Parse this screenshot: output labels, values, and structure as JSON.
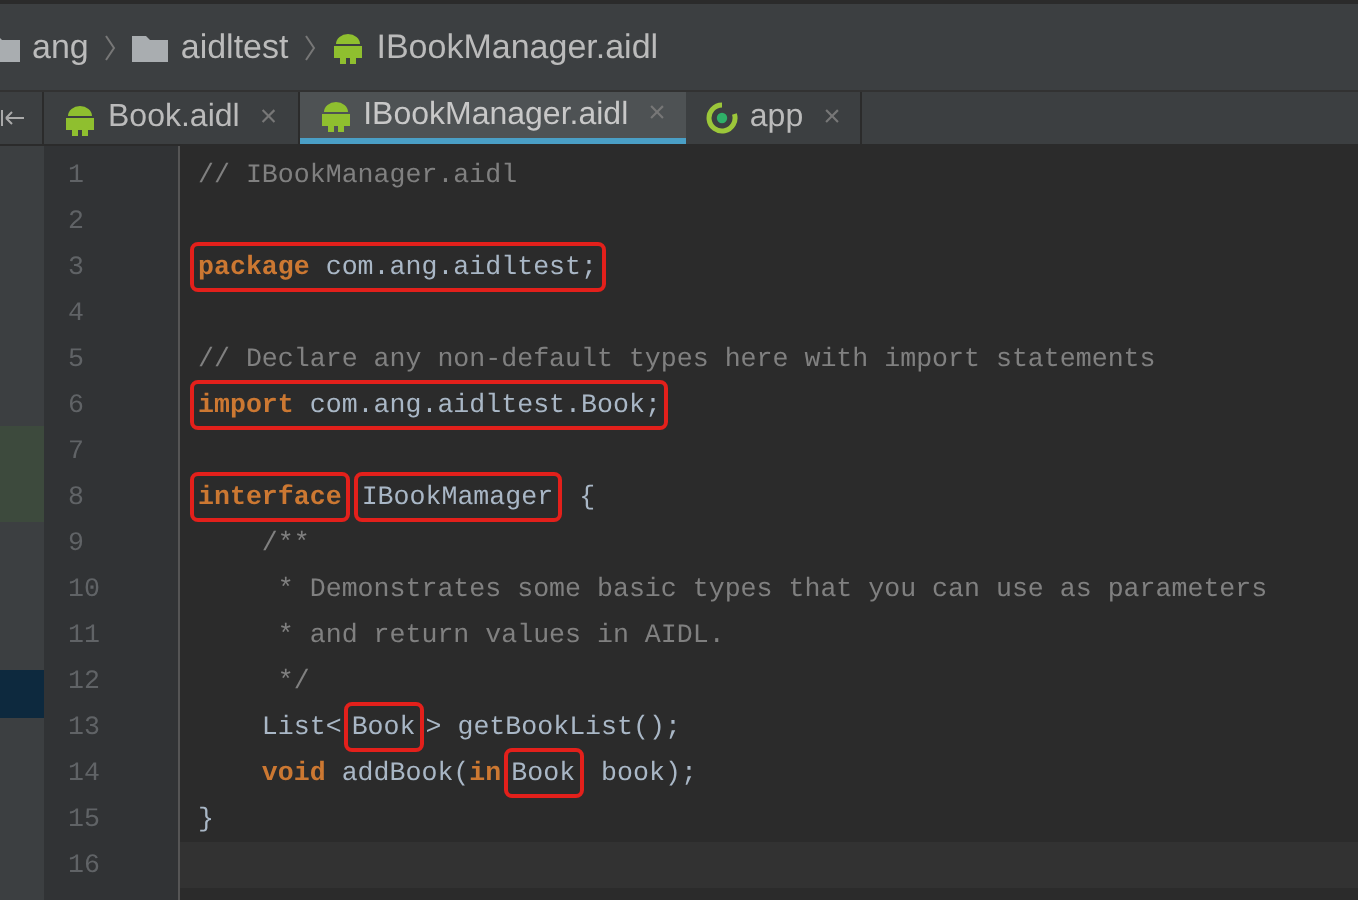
{
  "breadcrumb": [
    {
      "kind": "folder",
      "label": "ang"
    },
    {
      "kind": "folder",
      "label": "aidltest"
    },
    {
      "kind": "android",
      "label": "IBookManager.aidl"
    }
  ],
  "tabs": [
    {
      "kind": "android",
      "label": "Book.aidl",
      "selected": false,
      "close": "×"
    },
    {
      "kind": "android",
      "label": "IBookManager.aidl",
      "selected": true,
      "close": "×"
    },
    {
      "kind": "module",
      "label": "app",
      "selected": false,
      "close": "×"
    }
  ],
  "lines": [
    {
      "number": "1",
      "segments": [
        {
          "boxed": false,
          "tokens": [
            {
              "kind": "comment",
              "text": "// IBookManager.aidl"
            }
          ]
        }
      ]
    },
    {
      "number": "2"
    },
    {
      "number": "3",
      "segments": [
        {
          "boxed": true,
          "tokens": [
            {
              "kind": "keyword",
              "text": "package"
            },
            {
              "kind": "plain",
              "text": " com.ang.aidltest;"
            }
          ]
        }
      ]
    },
    {
      "number": "4"
    },
    {
      "number": "5",
      "segments": [
        {
          "boxed": false,
          "tokens": [
            {
              "kind": "comment",
              "text": "// Declare any non-default types here with import statements"
            }
          ]
        }
      ]
    },
    {
      "number": "6",
      "segments": [
        {
          "boxed": true,
          "tokens": [
            {
              "kind": "keyword",
              "text": "import"
            },
            {
              "kind": "plain",
              "text": " com.ang.aidltest.Book;"
            }
          ]
        }
      ]
    },
    {
      "number": "7"
    },
    {
      "number": "8",
      "segments": [
        {
          "boxed": true,
          "tokens": [
            {
              "kind": "keyword",
              "text": "interface"
            }
          ]
        },
        {
          "boxed": true,
          "tokens": [
            {
              "kind": "plain",
              "text": "IBookMamager"
            }
          ]
        },
        {
          "boxed": false,
          "tokens": [
            {
              "kind": "plain",
              "text": " {"
            }
          ]
        }
      ]
    },
    {
      "number": "9",
      "segments": [
        {
          "boxed": false,
          "tokens": [
            {
              "kind": "comment",
              "text": "    /**"
            }
          ]
        }
      ]
    },
    {
      "number": "10",
      "segments": [
        {
          "boxed": false,
          "tokens": [
            {
              "kind": "comment",
              "text": "     * Demonstrates some basic types that you can use as parameters"
            }
          ]
        }
      ]
    },
    {
      "number": "11",
      "segments": [
        {
          "boxed": false,
          "tokens": [
            {
              "kind": "comment",
              "text": "     * and return values in AIDL."
            }
          ]
        }
      ]
    },
    {
      "number": "12",
      "segments": [
        {
          "boxed": false,
          "tokens": [
            {
              "kind": "comment",
              "text": "     */"
            }
          ]
        }
      ]
    },
    {
      "number": "13",
      "segments": [
        {
          "boxed": false,
          "tokens": [
            {
              "kind": "plain",
              "text": "    List<"
            }
          ]
        },
        {
          "boxed": true,
          "tokens": [
            {
              "kind": "plain",
              "text": "Book"
            }
          ]
        },
        {
          "boxed": false,
          "tokens": [
            {
              "kind": "plain",
              "text": "> getBookList();"
            }
          ]
        }
      ]
    },
    {
      "number": "14",
      "segments": [
        {
          "boxed": false,
          "tokens": [
            {
              "kind": "keyword",
              "text": "    void"
            },
            {
              "kind": "plain",
              "text": " addBook("
            },
            {
              "kind": "keyword",
              "text": "in"
            }
          ]
        },
        {
          "boxed": true,
          "tokens": [
            {
              "kind": "plain",
              "text": "Book"
            }
          ]
        },
        {
          "boxed": false,
          "tokens": [
            {
              "kind": "plain",
              "text": " book);"
            }
          ]
        }
      ]
    },
    {
      "number": "15",
      "segments": [
        {
          "boxed": false,
          "tokens": [
            {
              "kind": "plain",
              "text": "}"
            }
          ]
        }
      ]
    },
    {
      "number": "16"
    }
  ]
}
